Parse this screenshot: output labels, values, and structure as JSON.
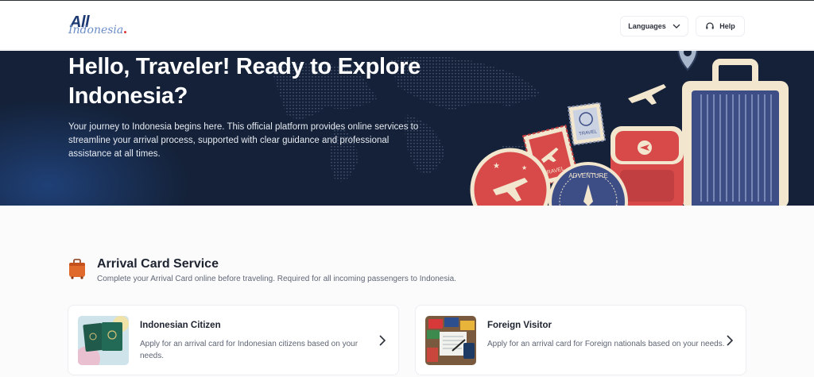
{
  "header": {
    "logo_main": "All",
    "logo_sub": "Indonesia",
    "languages_label": "Languages",
    "help_label": "Help"
  },
  "hero": {
    "title": "Hello, Traveler! Ready to Explore Indonesia?",
    "description": "Your journey to Indonesia begins here. This official platform provides online services to streamline your arrival process, supported with clear guidance and professional assistance at all times.",
    "stamp_travel": "TRAVEL",
    "stamp_travel_small": "TRAVEL",
    "stamp_adventure": "ADVENTURE"
  },
  "section": {
    "title": "Arrival Card Service",
    "subtitle": "Complete your Arrival Card online before traveling. Required for all incoming passengers to Indonesia."
  },
  "cards": [
    {
      "title": "Indonesian Citizen",
      "description": "Apply for an arrival card for Indonesian citizens based on your needs."
    },
    {
      "title": "Foreign Visitor",
      "description": "Apply for an arrival card for Foreign nationals based on your needs."
    }
  ],
  "colors": {
    "hero_bg": "#142138",
    "accent_red": "#d84a4a",
    "cream": "#f3e6cf",
    "navy": "#1d3a73"
  }
}
